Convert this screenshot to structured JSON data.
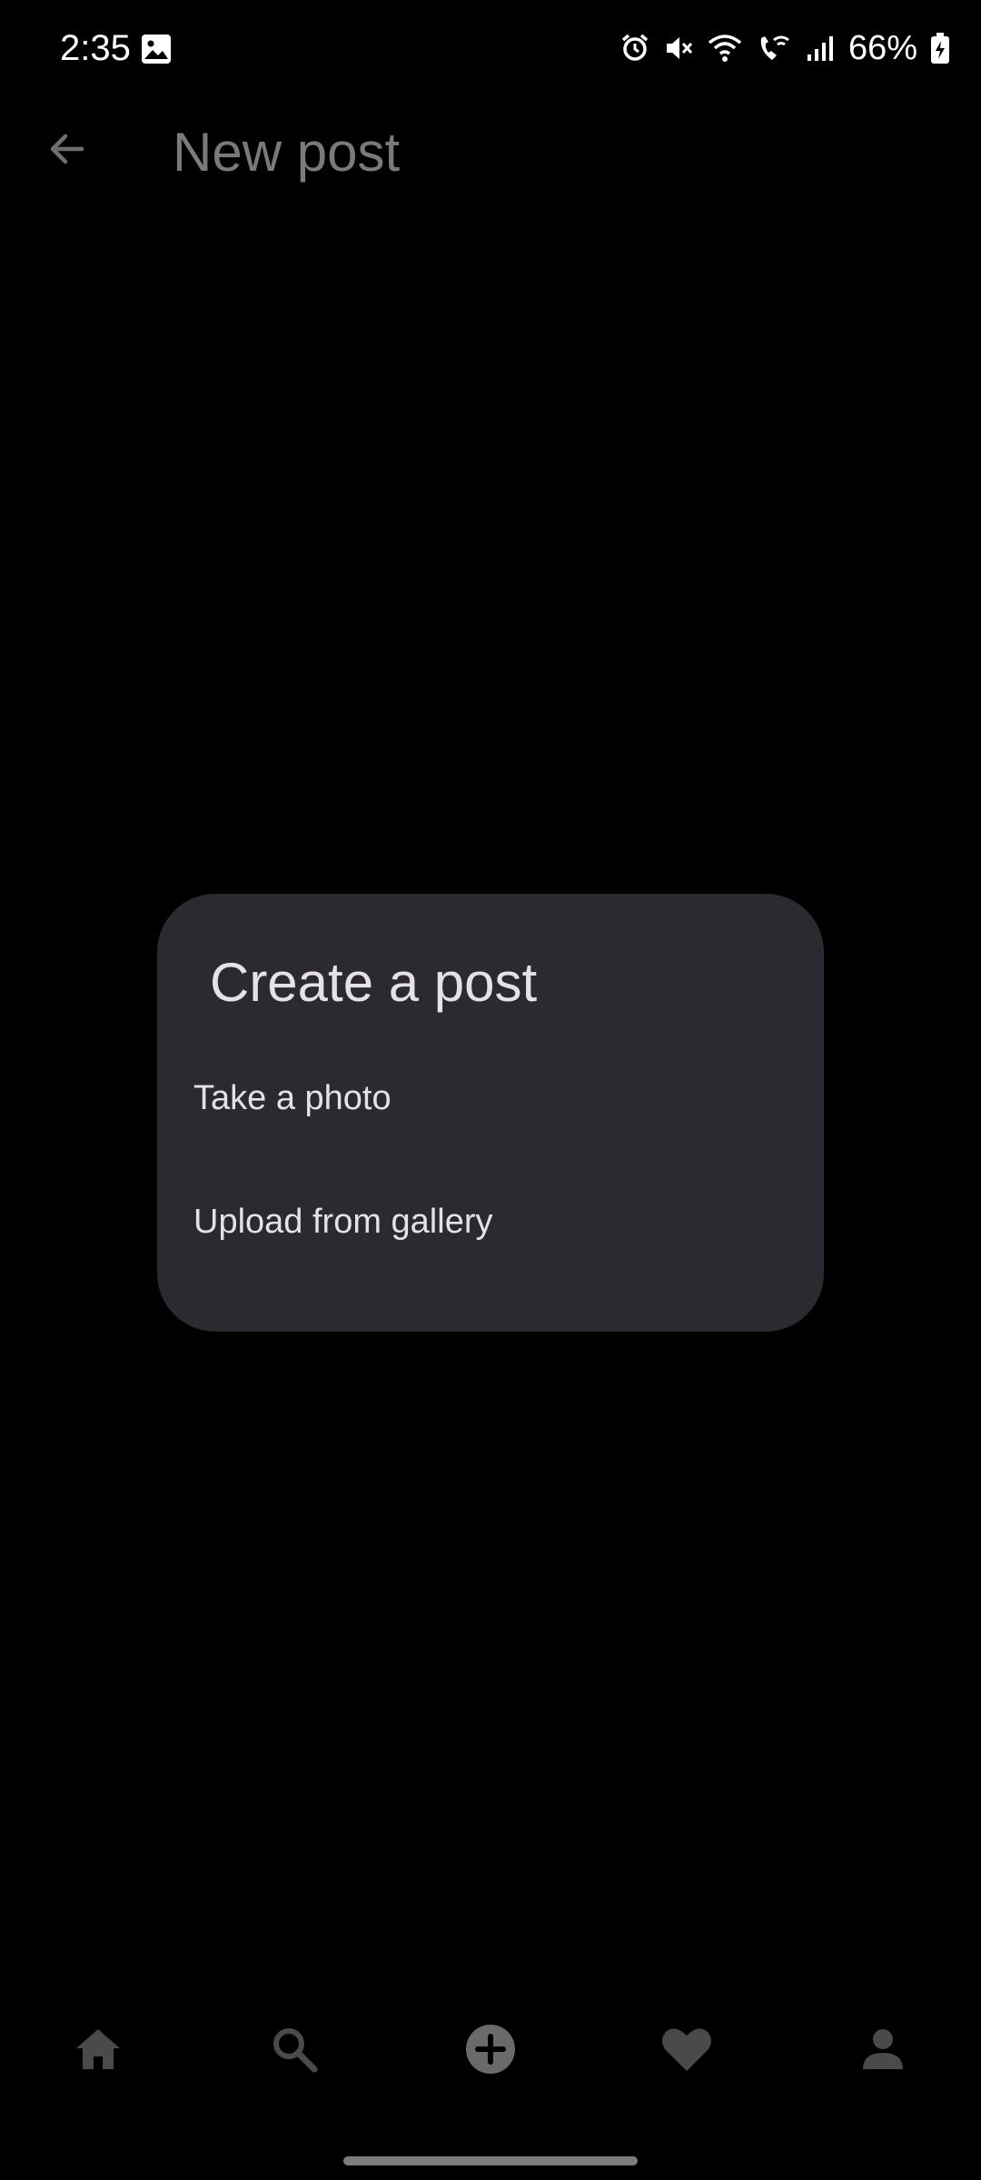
{
  "status_bar": {
    "time": "2:35",
    "battery": "66%",
    "icons": [
      "gallery-icon",
      "alarm-icon",
      "mute-icon",
      "wifi-icon",
      "wifi-call-icon",
      "signal-icon",
      "battery-charging-icon"
    ]
  },
  "app_bar": {
    "title": "New post",
    "back_icon": "arrow-back-icon"
  },
  "dialog": {
    "title": "Create a post",
    "options": [
      {
        "label": "Take a photo"
      },
      {
        "label": "Upload from gallery"
      }
    ]
  },
  "bottom_nav": {
    "items": [
      {
        "icon": "home-icon"
      },
      {
        "icon": "search-icon"
      },
      {
        "icon": "add-circle-icon"
      },
      {
        "icon": "heart-icon"
      },
      {
        "icon": "person-icon"
      }
    ]
  },
  "colors": {
    "background": "#000000",
    "dialog": "#2b2a31",
    "dialog_text": "#e6e1e8",
    "dimmed_icon": "#4a4a4a",
    "dimmed_title": "#7a7a7a"
  }
}
